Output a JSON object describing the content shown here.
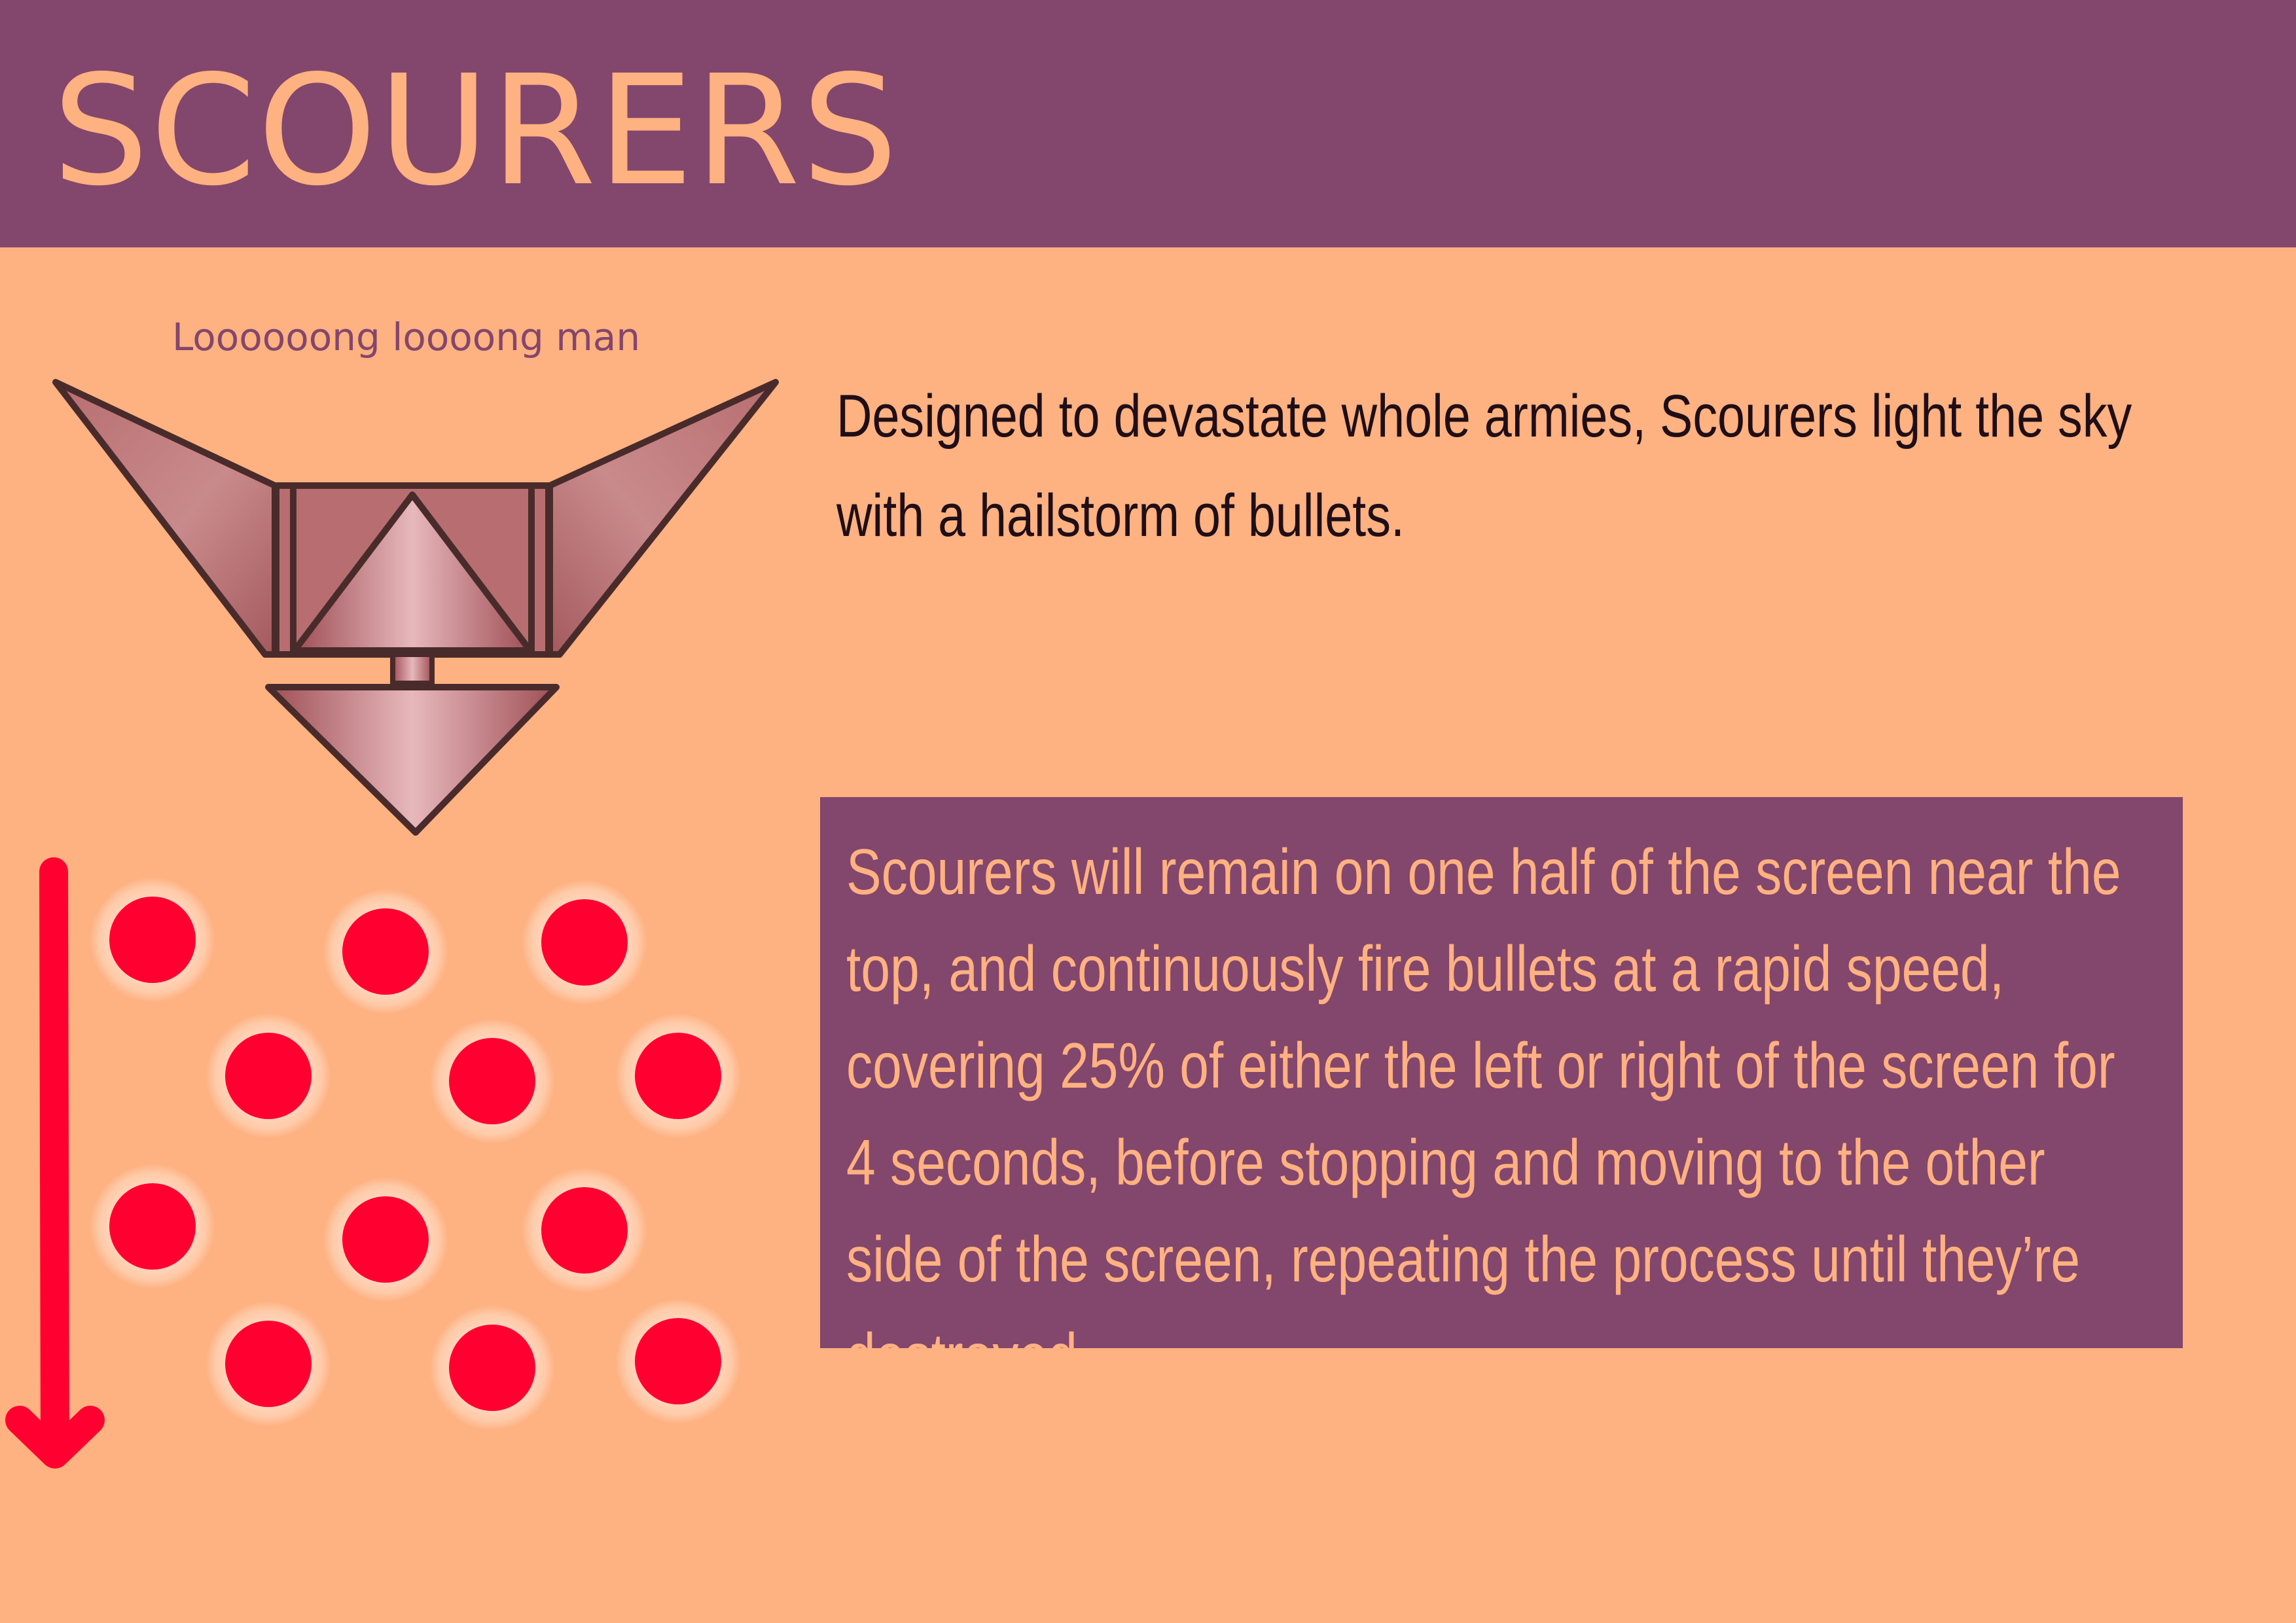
{
  "header": {
    "title": "SCOURERS"
  },
  "enemy": {
    "caption": "Loooooong loooong man",
    "description": "Designed to devastate whole armies, Scourers light the sky with a hailstorm of bullets.",
    "ship_icon": "scourer-ship-icon"
  },
  "behaviour": {
    "text": "Scourers will remain on one half of the screen near the top, and continuously fire bullets at a rapid speed, covering 25% of either the left or right of the screen for 4 seconds, before stopping and moving to the other side of the screen, repeating the process until they’re destroyed."
  },
  "bullet_pattern": {
    "icon": "bullet-icon",
    "direction_icon": "arrow-down-icon",
    "direction": "down",
    "bullet_count": 12
  },
  "colors": {
    "background": "#FEB181",
    "header": "#83466C",
    "accent_text": "#FEB181",
    "ship_fill": "#B86E70",
    "ship_outline": "#4A2B2B",
    "bullet": "#FF0030",
    "bullet_glow": "#FFD0B5",
    "arrow": "#FF0030"
  }
}
